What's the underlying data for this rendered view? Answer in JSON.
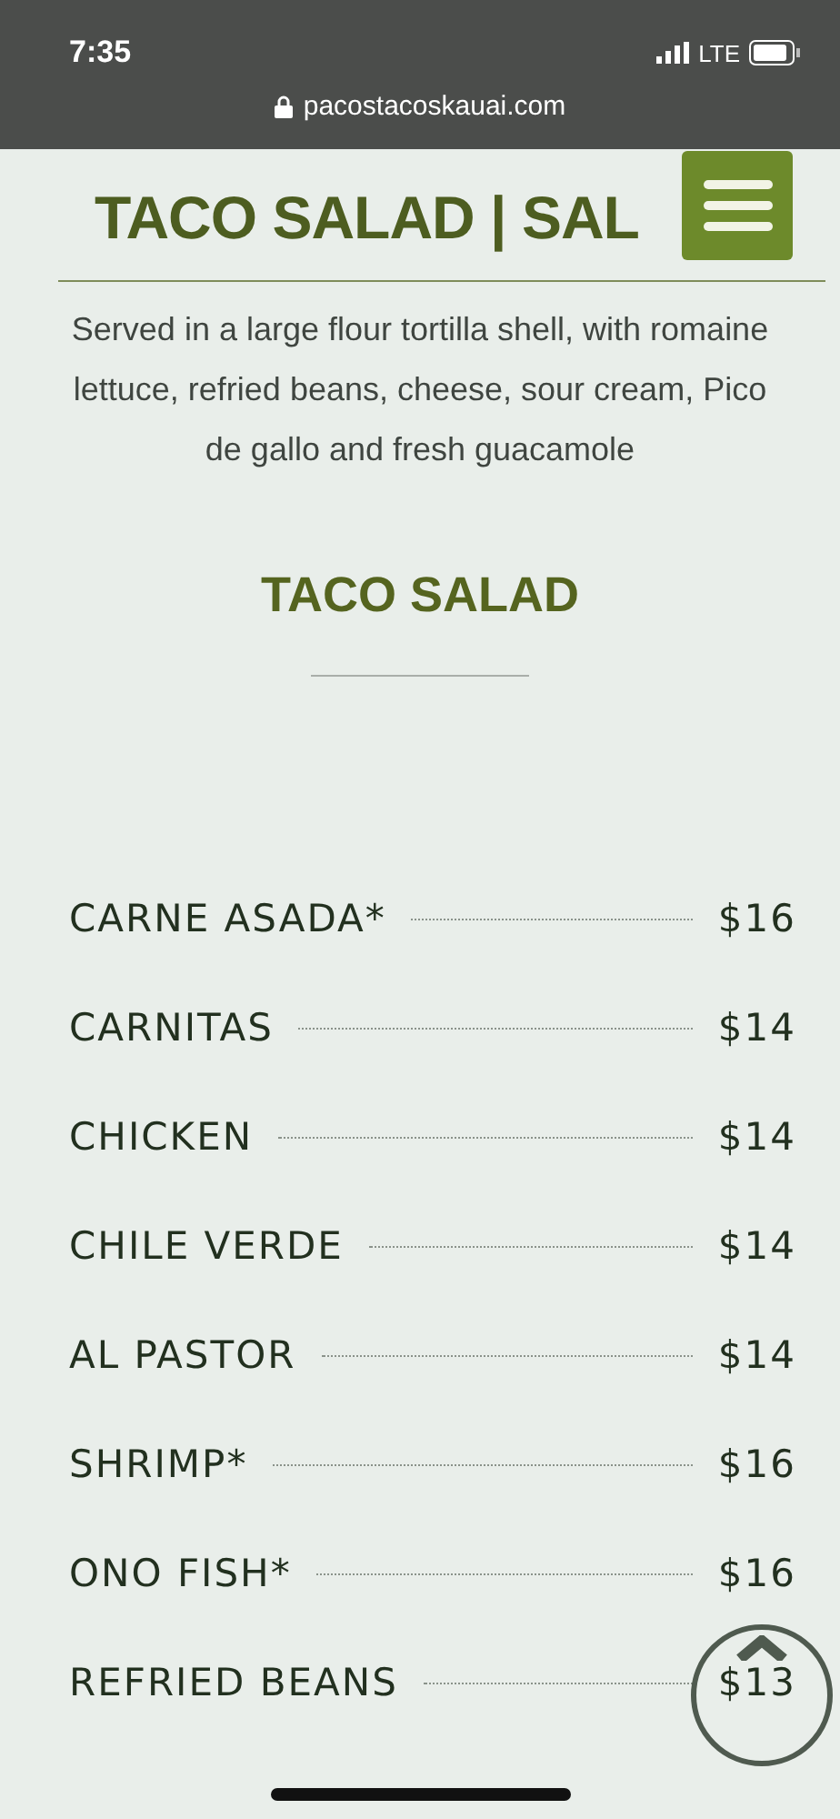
{
  "status_bar": {
    "time": "7:35",
    "network": "LTE"
  },
  "address_bar": {
    "url": "pacostacoskauai.com"
  },
  "page_title": "TACO SALAD | SAL",
  "description": "Served in a large flour tortilla shell, with romaine lettuce, refried beans, cheese, sour cream, Pico de gallo and fresh guacamole",
  "section": {
    "heading": "TACO SALAD"
  },
  "items": [
    {
      "name": "CARNE ASADA*",
      "price": "$16"
    },
    {
      "name": "CARNITAS",
      "price": "$14"
    },
    {
      "name": "CHICKEN",
      "price": "$14"
    },
    {
      "name": "CHILE VERDE",
      "price": "$14"
    },
    {
      "name": "AL PASTOR",
      "price": "$14"
    },
    {
      "name": "SHRIMP*",
      "price": "$16"
    },
    {
      "name": "ONO FISH*",
      "price": "$16"
    },
    {
      "name": "REFRIED BEANS",
      "price": "$13"
    }
  ]
}
